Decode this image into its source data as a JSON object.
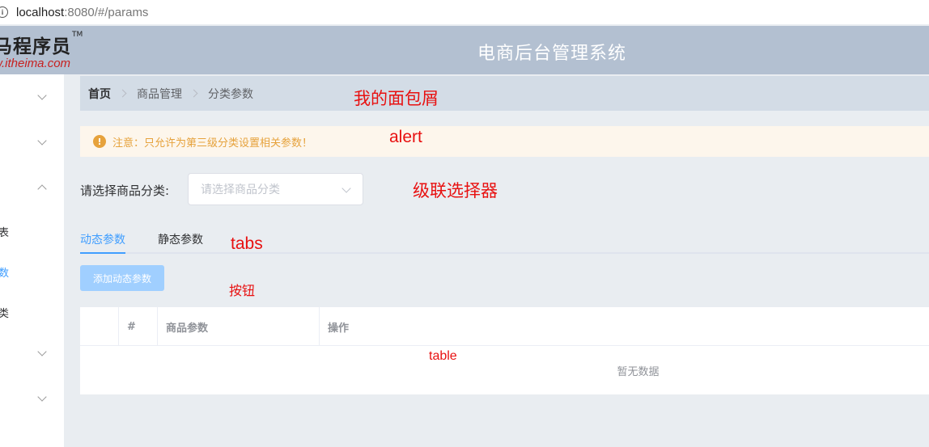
{
  "url": {
    "host": "localhost",
    "path": ":8080/#/params"
  },
  "header": {
    "logo_text": "马程序员",
    "logo_tm": "TM",
    "logo_url": "w.itheima.com",
    "title": "电商后台管理系统"
  },
  "sidebar": {
    "items": [
      {
        "label": "表"
      },
      {
        "label": "数"
      },
      {
        "label": "类"
      }
    ]
  },
  "breadcrumb": {
    "items": [
      "首页",
      "商品管理",
      "分类参数"
    ]
  },
  "alert": {
    "text": "注意：只允许为第三级分类设置相关参数！"
  },
  "cascader": {
    "label": "请选择商品分类:",
    "placeholder": "请选择商品分类"
  },
  "tabs": {
    "items": [
      "动态参数",
      "静态参数"
    ]
  },
  "add_button": {
    "label": "添加动态参数"
  },
  "table": {
    "headers": [
      "",
      "#",
      "商品参数",
      "操作"
    ],
    "empty_text": "暂无数据"
  },
  "annotations": {
    "breadcrumb": "我的面包屑",
    "alert": "alert",
    "cascader": "级联选择器",
    "tabs": "tabs",
    "button": "按钮",
    "table": "table"
  },
  "colors": {
    "primary": "#409eff",
    "header_bg": "#b3c0d1",
    "breadcrumb_bg": "#d3dce6",
    "warning": "#e6a23c",
    "annotation": "#e81010"
  }
}
